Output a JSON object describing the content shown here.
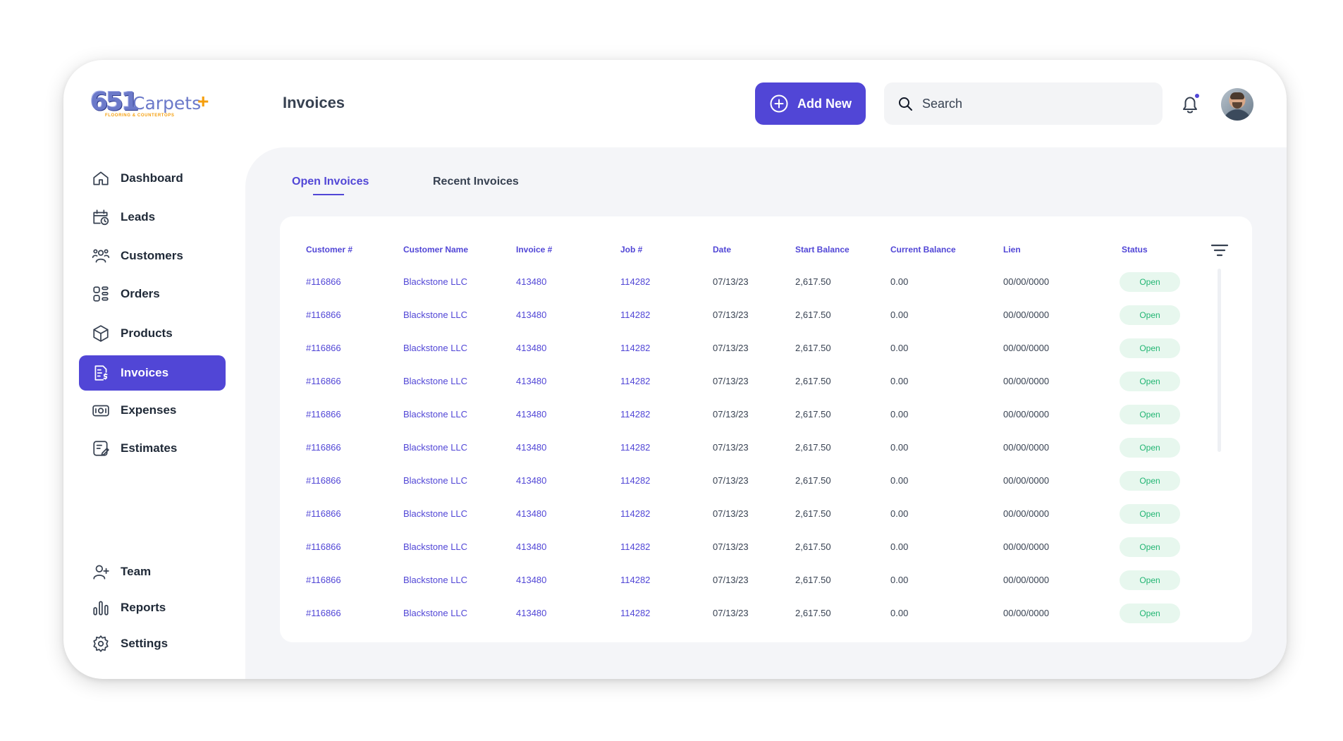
{
  "brand": {
    "mark": "651",
    "word": "Carpets",
    "plus": "+",
    "tagline": "FLOORING & COUNTERTOPS"
  },
  "header": {
    "title": "Invoices",
    "add_label": "Add New",
    "search_placeholder": "Search"
  },
  "sidebar": {
    "items": [
      {
        "label": "Dashboard",
        "icon": "home-icon"
      },
      {
        "label": "Leads",
        "icon": "calendar-clock-icon"
      },
      {
        "label": "Customers",
        "icon": "users-icon"
      },
      {
        "label": "Orders",
        "icon": "grid-icon"
      },
      {
        "label": "Products",
        "icon": "box-icon"
      },
      {
        "label": "Invoices",
        "icon": "invoice-icon",
        "active": true
      },
      {
        "label": "Expenses",
        "icon": "cash-icon"
      },
      {
        "label": "Estimates",
        "icon": "estimate-icon"
      }
    ],
    "bottom_items": [
      {
        "label": "Team",
        "icon": "user-plus-icon"
      },
      {
        "label": "Reports",
        "icon": "bar-chart-icon"
      },
      {
        "label": "Settings",
        "icon": "gear-icon"
      }
    ]
  },
  "tabs": {
    "open": "Open Invoices",
    "recent": "Recent Invoices",
    "selected": "Open Invoices"
  },
  "table": {
    "columns": [
      "Customer #",
      "Customer Name",
      "Invoice #",
      "Job #",
      "Date",
      "Start Balance",
      "Current Balance",
      "Lien",
      "Status"
    ],
    "rows": [
      [
        "#116866",
        "Blackstone LLC",
        "413480",
        "114282",
        "07/13/23",
        "2,617.50",
        "0.00",
        "00/00/0000",
        "Open"
      ],
      [
        "#116866",
        "Blackstone LLC",
        "413480",
        "114282",
        "07/13/23",
        "2,617.50",
        "0.00",
        "00/00/0000",
        "Open"
      ],
      [
        "#116866",
        "Blackstone LLC",
        "413480",
        "114282",
        "07/13/23",
        "2,617.50",
        "0.00",
        "00/00/0000",
        "Open"
      ],
      [
        "#116866",
        "Blackstone LLC",
        "413480",
        "114282",
        "07/13/23",
        "2,617.50",
        "0.00",
        "00/00/0000",
        "Open"
      ],
      [
        "#116866",
        "Blackstone LLC",
        "413480",
        "114282",
        "07/13/23",
        "2,617.50",
        "0.00",
        "00/00/0000",
        "Open"
      ],
      [
        "#116866",
        "Blackstone LLC",
        "413480",
        "114282",
        "07/13/23",
        "2,617.50",
        "0.00",
        "00/00/0000",
        "Open"
      ],
      [
        "#116866",
        "Blackstone LLC",
        "413480",
        "114282",
        "07/13/23",
        "2,617.50",
        "0.00",
        "00/00/0000",
        "Open"
      ],
      [
        "#116866",
        "Blackstone LLC",
        "413480",
        "114282",
        "07/13/23",
        "2,617.50",
        "0.00",
        "00/00/0000",
        "Open"
      ],
      [
        "#116866",
        "Blackstone LLC",
        "413480",
        "114282",
        "07/13/23",
        "2,617.50",
        "0.00",
        "00/00/0000",
        "Open"
      ],
      [
        "#116866",
        "Blackstone LLC",
        "413480",
        "114282",
        "07/13/23",
        "2,617.50",
        "0.00",
        "00/00/0000",
        "Open"
      ],
      [
        "#116866",
        "Blackstone LLC",
        "413480",
        "114282",
        "07/13/23",
        "2,617.50",
        "0.00",
        "00/00/0000",
        "Open"
      ]
    ]
  },
  "colors": {
    "accent": "#5146d6",
    "status_open_bg": "#e7f7ee",
    "status_open_text": "#22b573",
    "logo_orange": "#f59e0b"
  }
}
